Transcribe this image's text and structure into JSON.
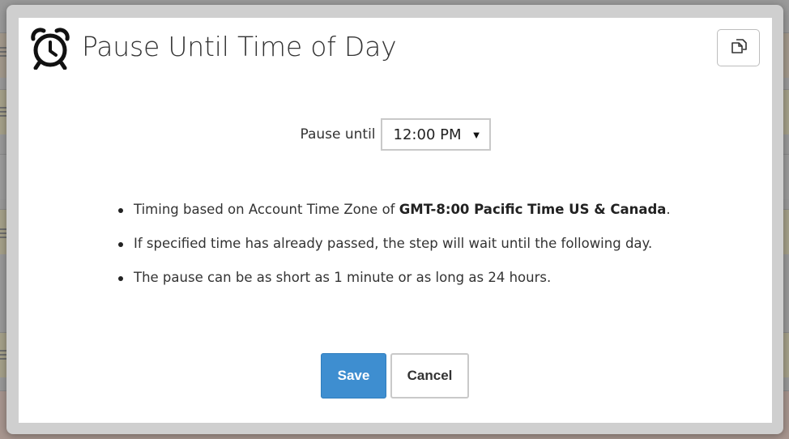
{
  "dialog": {
    "title": "Pause Until Time of Day",
    "header_icon": "alarm-clock-icon",
    "copy_icon": "copy-icon"
  },
  "pause": {
    "label": "Pause until",
    "selected_time": "12:00 PM",
    "caret": "▼"
  },
  "info": {
    "timezone_prefix": "Timing based on Account Time Zone of ",
    "timezone_value": "GMT-8:00 Pacific Time US & Canada",
    "timezone_suffix": ".",
    "passed_note": "If specified time has already passed, the step will wait until the following day.",
    "duration_note": "The pause can be as short as 1 minute or as long as 24 hours."
  },
  "actions": {
    "save_label": "Save",
    "cancel_label": "Cancel"
  },
  "colors": {
    "primary_button": "#3e8ed0",
    "overlay": "#9a9a9a"
  }
}
